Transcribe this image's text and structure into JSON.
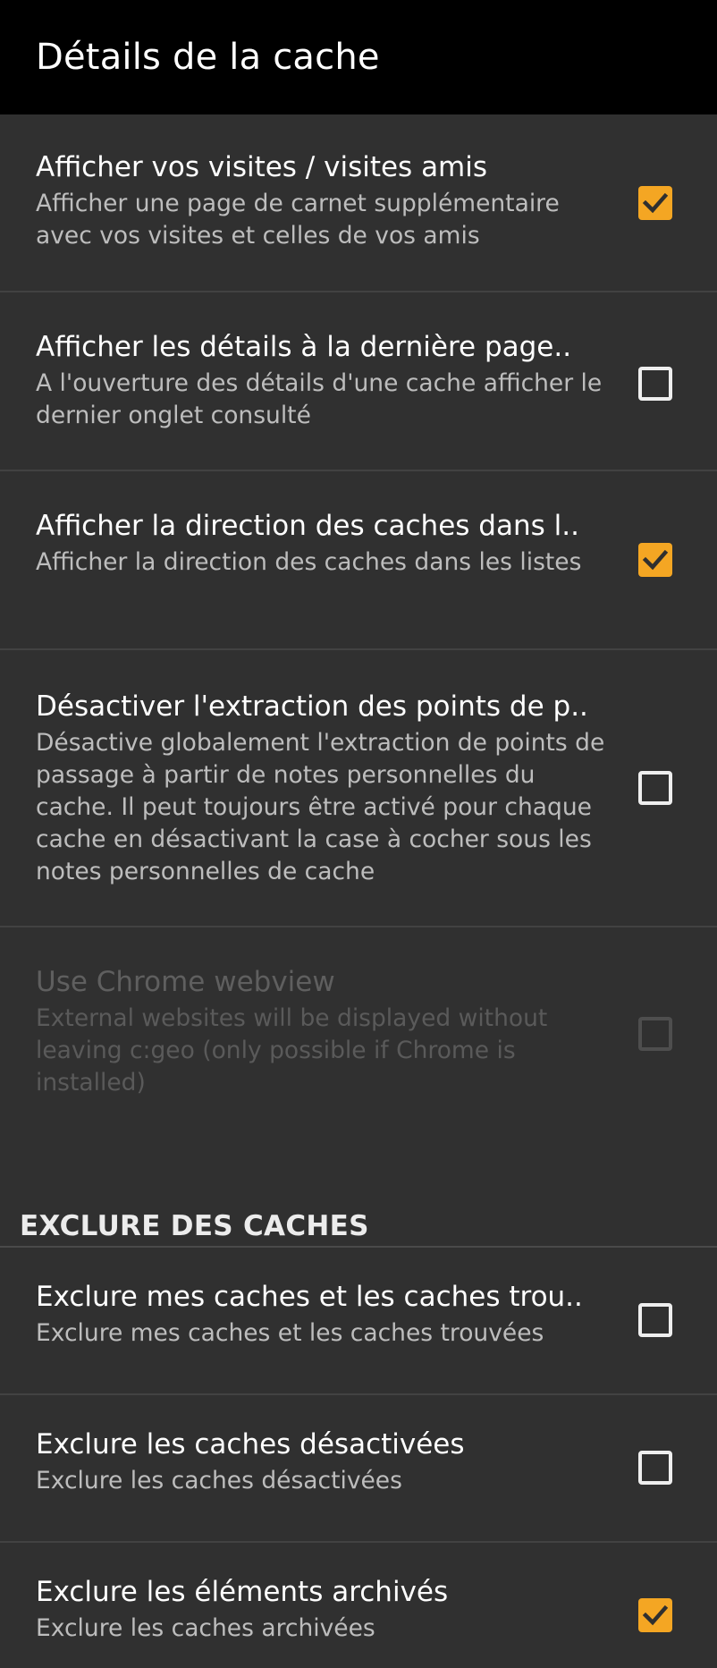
{
  "topbar": {
    "title": "Détails de la cache"
  },
  "prefs": [
    {
      "title": "Afficher vos visites / visites amis",
      "summary": "Afficher une page de carnet supplémentaire avec vos visites et celles de vos amis",
      "checked": true,
      "enabled": true
    },
    {
      "title": "Afficher les détails à la dernière page..",
      "summary": "A l'ouverture des détails d'une cache afficher le dernier onglet consulté",
      "checked": false,
      "enabled": true
    },
    {
      "title": "Afficher la direction des caches dans l..",
      "summary": "Afficher la direction des caches dans les listes",
      "checked": true,
      "enabled": true
    },
    {
      "title": "Désactiver l'extraction des points de p..",
      "summary": "Désactive globalement l'extraction de points de passage à partir de notes personnelles du cache. Il peut toujours être activé pour chaque cache en désactivant la case à cocher sous les notes personnelles de cache",
      "checked": false,
      "enabled": true
    },
    {
      "title": "Use Chrome webview",
      "summary": "External websites will be displayed without leaving c:geo (only possible if Chrome is installed)",
      "checked": false,
      "enabled": false
    }
  ],
  "section": {
    "title": "EXCLURE DES CACHES"
  },
  "exclude_prefs": [
    {
      "title": "Exclure mes caches et les caches trou..",
      "summary": "Exclure mes caches et les caches trouvées",
      "checked": false,
      "enabled": true
    },
    {
      "title": "Exclure les caches désactivées",
      "summary": "Exclure les caches désactivées",
      "checked": false,
      "enabled": true
    },
    {
      "title": "Exclure les éléments archivés",
      "summary": "Exclure les caches archivées",
      "checked": true,
      "enabled": true
    }
  ],
  "colors": {
    "accent": "#f4a623",
    "topbar": "#000000",
    "background": "#303030"
  }
}
